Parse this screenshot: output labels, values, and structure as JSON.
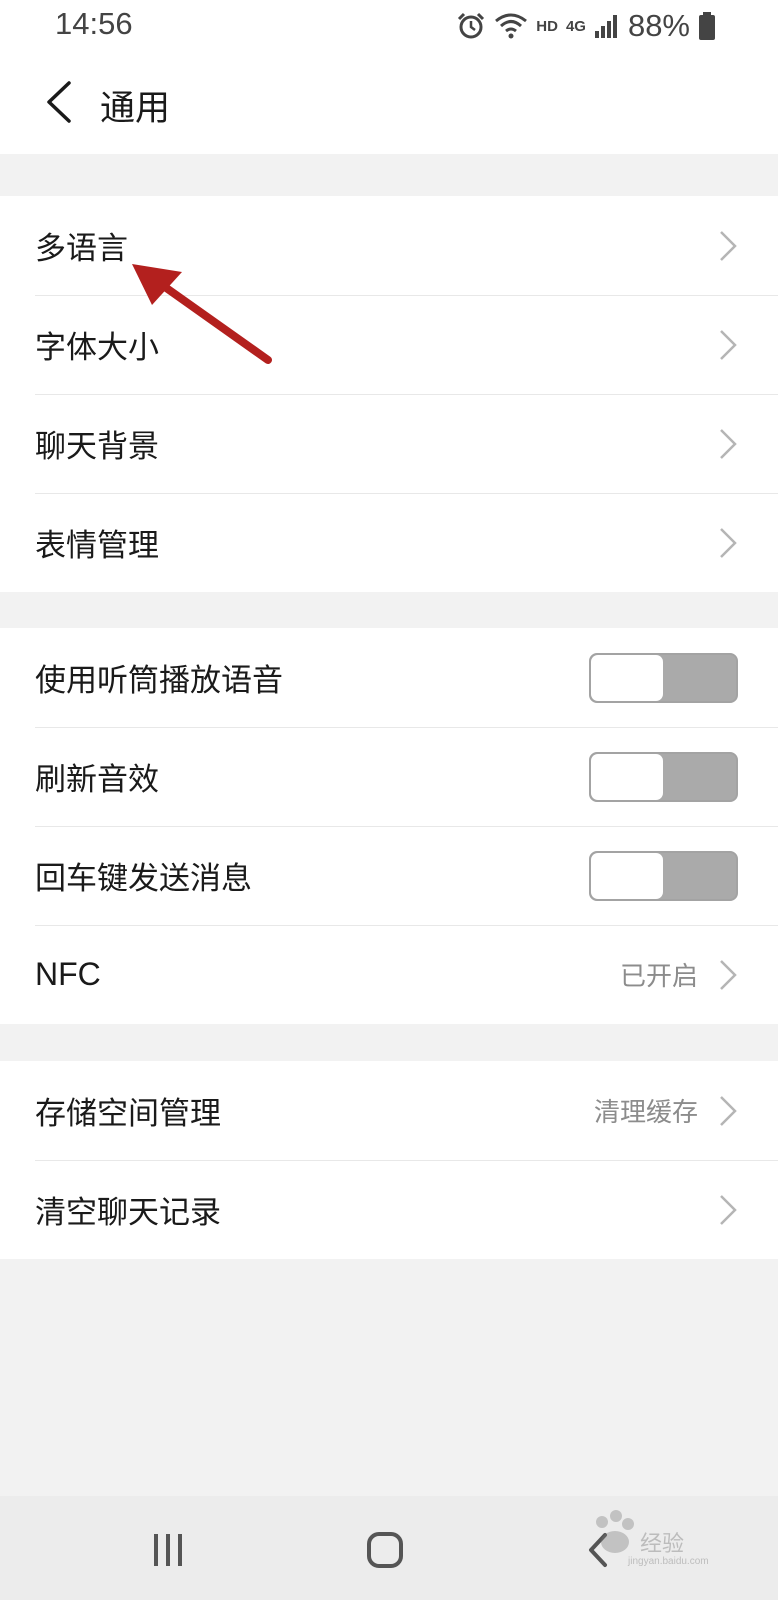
{
  "status_bar": {
    "time": "14:56",
    "network_hd": "HD",
    "network_type": "4G",
    "battery": "88%"
  },
  "header": {
    "title": "通用"
  },
  "groups": [
    {
      "items": [
        {
          "label": "多语言"
        },
        {
          "label": "字体大小"
        },
        {
          "label": "聊天背景"
        },
        {
          "label": "表情管理"
        }
      ]
    },
    {
      "items": [
        {
          "label": "使用听筒播放语音",
          "toggle_on": false
        },
        {
          "label": "刷新音效",
          "toggle_on": false
        },
        {
          "label": "回车键发送消息",
          "toggle_on": false
        },
        {
          "label": "NFC",
          "value": "已开启"
        }
      ]
    },
    {
      "items": [
        {
          "label": "存储空间管理",
          "value": "清理缓存"
        },
        {
          "label": "清空聊天记录"
        }
      ]
    }
  ],
  "annotation": {
    "arrow_color": "#b3201e"
  },
  "watermark": {
    "logo_text": "Bai du",
    "text": "经验",
    "url": "jingyan.baidu.com"
  }
}
